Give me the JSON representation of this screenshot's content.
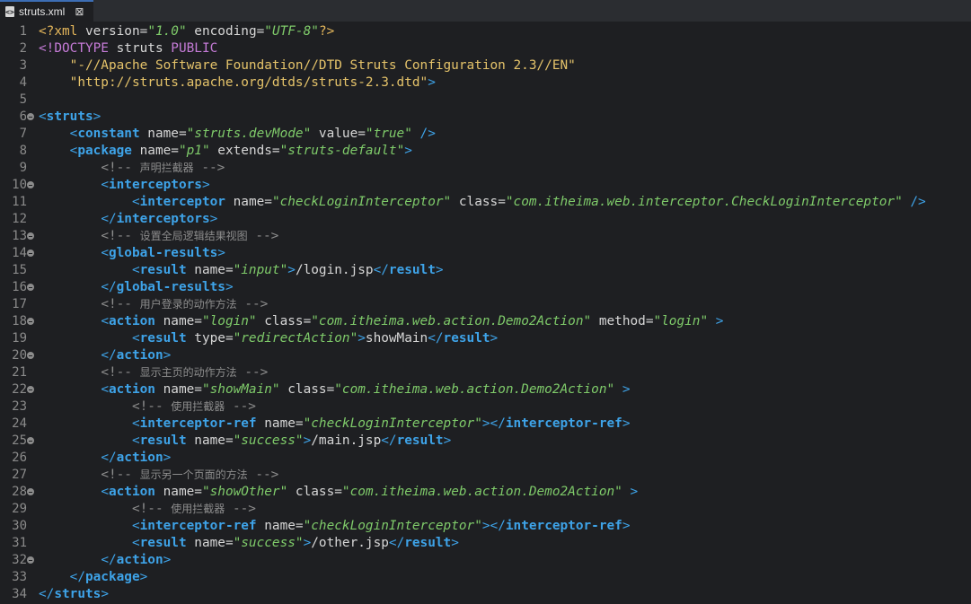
{
  "tab": {
    "filename": "struts.xml",
    "close_glyph": "⊠",
    "icon": "xml-file-icon"
  },
  "editor": {
    "line_numbers": [
      "1",
      "2",
      "3",
      "4",
      "5",
      "6",
      "7",
      "8",
      "9",
      "10",
      "11",
      "12",
      "13",
      "14",
      "15",
      "16",
      "17",
      "18",
      "19",
      "20",
      "21",
      "22",
      "23",
      "24",
      "25",
      "26",
      "27",
      "28",
      "29",
      "30",
      "31",
      "32",
      "33",
      "34"
    ],
    "fold_lines": [
      6,
      10,
      13,
      14,
      16,
      18,
      20,
      22,
      25,
      28,
      32
    ],
    "colors": {
      "background": "#1e1f22",
      "tag": "#3ea3e8",
      "attr_value": "#7fcb6a",
      "string": "#e5c36a",
      "doctype": "#c57bd7",
      "comment": "#8d8d8d"
    },
    "lines": [
      [
        [
          "t",
          "<?"
        ],
        [
          "t",
          "xml"
        ],
        [
          "an",
          " version="
        ],
        [
          "av",
          "\"1.0\""
        ],
        [
          "an",
          " encoding="
        ],
        [
          "av",
          "\"UTF-8\""
        ],
        [
          "t",
          "?>"
        ]
      ],
      [
        [
          "dk",
          "<!DOCTYPE"
        ],
        [
          "an",
          " struts "
        ],
        [
          "dk",
          "PUBLIC"
        ]
      ],
      [
        [
          "an",
          "    "
        ],
        [
          "s",
          "\"-//Apache Software Foundation//DTD Struts Configuration 2.3//EN\""
        ]
      ],
      [
        [
          "an",
          "    "
        ],
        [
          "s",
          "\"http://struts.apache.org/dtds/struts-2.3.dtd\""
        ],
        [
          "br",
          ">"
        ]
      ],
      [],
      [
        [
          "br",
          "<"
        ],
        [
          "tn",
          "struts"
        ],
        [
          "br",
          ">"
        ]
      ],
      [
        [
          "an",
          "    "
        ],
        [
          "br",
          "<"
        ],
        [
          "tn",
          "constant"
        ],
        [
          "an",
          " name="
        ],
        [
          "av",
          "\"struts.devMode\""
        ],
        [
          "an",
          " value="
        ],
        [
          "av",
          "\"true\""
        ],
        [
          "br",
          " />"
        ]
      ],
      [
        [
          "an",
          "    "
        ],
        [
          "br",
          "<"
        ],
        [
          "tn",
          "package"
        ],
        [
          "an",
          " name="
        ],
        [
          "av",
          "\"p1\""
        ],
        [
          "an",
          " extends="
        ],
        [
          "av",
          "\"struts-default\""
        ],
        [
          "br",
          ">"
        ]
      ],
      [
        [
          "an",
          "        "
        ],
        [
          "cm",
          "<!-- "
        ],
        [
          "cmcjk",
          "声明拦截器"
        ],
        [
          "cm",
          " -->"
        ]
      ],
      [
        [
          "an",
          "        "
        ],
        [
          "br",
          "<"
        ],
        [
          "tn",
          "interceptors"
        ],
        [
          "br",
          ">"
        ]
      ],
      [
        [
          "an",
          "            "
        ],
        [
          "br",
          "<"
        ],
        [
          "tn",
          "interceptor"
        ],
        [
          "an",
          " name="
        ],
        [
          "av",
          "\"checkLoginInterceptor\""
        ],
        [
          "an",
          " class="
        ],
        [
          "av",
          "\"com.itheima.web.interceptor.CheckLoginInterceptor\""
        ],
        [
          "br",
          " />"
        ]
      ],
      [
        [
          "an",
          "        "
        ],
        [
          "br",
          "</"
        ],
        [
          "tn",
          "interceptors"
        ],
        [
          "br",
          ">"
        ]
      ],
      [
        [
          "an",
          "        "
        ],
        [
          "cm",
          "<!-- "
        ],
        [
          "cmcjk",
          "设置全局逻辑结果视图"
        ],
        [
          "cm",
          " -->"
        ]
      ],
      [
        [
          "an",
          "        "
        ],
        [
          "br",
          "<"
        ],
        [
          "tn",
          "global-results"
        ],
        [
          "br",
          ">"
        ]
      ],
      [
        [
          "an",
          "            "
        ],
        [
          "br",
          "<"
        ],
        [
          "tn",
          "result"
        ],
        [
          "an",
          " name="
        ],
        [
          "av",
          "\"input\""
        ],
        [
          "br",
          ">"
        ],
        [
          "an",
          "/login.jsp"
        ],
        [
          "br",
          "</"
        ],
        [
          "tn",
          "result"
        ],
        [
          "br",
          ">"
        ]
      ],
      [
        [
          "an",
          "        "
        ],
        [
          "br",
          "</"
        ],
        [
          "tn",
          "global-results"
        ],
        [
          "br",
          ">"
        ]
      ],
      [
        [
          "an",
          "        "
        ],
        [
          "cm",
          "<!-- "
        ],
        [
          "cmcjk",
          "用户登录的动作方法"
        ],
        [
          "cm",
          " -->"
        ]
      ],
      [
        [
          "an",
          "        "
        ],
        [
          "br",
          "<"
        ],
        [
          "tn",
          "action"
        ],
        [
          "an",
          " name="
        ],
        [
          "av",
          "\"login\""
        ],
        [
          "an",
          " class="
        ],
        [
          "av",
          "\"com.itheima.web.action.Demo2Action\""
        ],
        [
          "an",
          " method="
        ],
        [
          "av",
          "\"login\""
        ],
        [
          "br",
          " >"
        ]
      ],
      [
        [
          "an",
          "            "
        ],
        [
          "br",
          "<"
        ],
        [
          "tn",
          "result"
        ],
        [
          "an",
          " type="
        ],
        [
          "av",
          "\"redirectAction\""
        ],
        [
          "br",
          ">"
        ],
        [
          "an",
          "showMain"
        ],
        [
          "br",
          "</"
        ],
        [
          "tn",
          "result"
        ],
        [
          "br",
          ">"
        ]
      ],
      [
        [
          "an",
          "        "
        ],
        [
          "br",
          "</"
        ],
        [
          "tn",
          "action"
        ],
        [
          "br",
          ">"
        ]
      ],
      [
        [
          "an",
          "        "
        ],
        [
          "cm",
          "<!-- "
        ],
        [
          "cmcjk",
          "显示主页的动作方法"
        ],
        [
          "cm",
          " -->"
        ]
      ],
      [
        [
          "an",
          "        "
        ],
        [
          "br",
          "<"
        ],
        [
          "tn",
          "action"
        ],
        [
          "an",
          " name="
        ],
        [
          "av",
          "\"showMain\""
        ],
        [
          "an",
          " class="
        ],
        [
          "av",
          "\"com.itheima.web.action.Demo2Action\""
        ],
        [
          "br",
          " >"
        ]
      ],
      [
        [
          "an",
          "            "
        ],
        [
          "cm",
          "<!-- "
        ],
        [
          "cmcjk",
          "使用拦截器"
        ],
        [
          "cm",
          " -->"
        ]
      ],
      [
        [
          "an",
          "            "
        ],
        [
          "br",
          "<"
        ],
        [
          "tn",
          "interceptor-ref"
        ],
        [
          "an",
          " name="
        ],
        [
          "av",
          "\"checkLoginInterceptor\""
        ],
        [
          "br",
          "></"
        ],
        [
          "tn",
          "interceptor-ref"
        ],
        [
          "br",
          ">"
        ]
      ],
      [
        [
          "an",
          "            "
        ],
        [
          "br",
          "<"
        ],
        [
          "tn",
          "result"
        ],
        [
          "an",
          " name="
        ],
        [
          "av",
          "\"success\""
        ],
        [
          "br",
          ">"
        ],
        [
          "an",
          "/main.jsp"
        ],
        [
          "br",
          "</"
        ],
        [
          "tn",
          "result"
        ],
        [
          "br",
          ">"
        ]
      ],
      [
        [
          "an",
          "        "
        ],
        [
          "br",
          "</"
        ],
        [
          "tn",
          "action"
        ],
        [
          "br",
          ">"
        ]
      ],
      [
        [
          "an",
          "        "
        ],
        [
          "cm",
          "<!-- "
        ],
        [
          "cmcjk",
          "显示另一个页面的方法"
        ],
        [
          "cm",
          " -->"
        ]
      ],
      [
        [
          "an",
          "        "
        ],
        [
          "br",
          "<"
        ],
        [
          "tn",
          "action"
        ],
        [
          "an",
          " name="
        ],
        [
          "av",
          "\"showOther\""
        ],
        [
          "an",
          " class="
        ],
        [
          "av",
          "\"com.itheima.web.action.Demo2Action\""
        ],
        [
          "br",
          " >"
        ]
      ],
      [
        [
          "an",
          "            "
        ],
        [
          "cm",
          "<!-- "
        ],
        [
          "cmcjk",
          "使用拦截器"
        ],
        [
          "cm",
          " -->"
        ]
      ],
      [
        [
          "an",
          "            "
        ],
        [
          "br",
          "<"
        ],
        [
          "tn",
          "interceptor-ref"
        ],
        [
          "an",
          " name="
        ],
        [
          "av",
          "\"checkLoginInterceptor\""
        ],
        [
          "br",
          "></"
        ],
        [
          "tn",
          "interceptor-ref"
        ],
        [
          "br",
          ">"
        ]
      ],
      [
        [
          "an",
          "            "
        ],
        [
          "br",
          "<"
        ],
        [
          "tn",
          "result"
        ],
        [
          "an",
          " name="
        ],
        [
          "av",
          "\"success\""
        ],
        [
          "br",
          ">"
        ],
        [
          "an",
          "/other.jsp"
        ],
        [
          "br",
          "</"
        ],
        [
          "tn",
          "result"
        ],
        [
          "br",
          ">"
        ]
      ],
      [
        [
          "an",
          "        "
        ],
        [
          "br",
          "</"
        ],
        [
          "tn",
          "action"
        ],
        [
          "br",
          ">"
        ]
      ],
      [
        [
          "an",
          "    "
        ],
        [
          "br",
          "</"
        ],
        [
          "tn",
          "package"
        ],
        [
          "br",
          ">"
        ]
      ],
      [
        [
          "br",
          "</"
        ],
        [
          "tn",
          "struts"
        ],
        [
          "br",
          ">"
        ]
      ]
    ]
  }
}
